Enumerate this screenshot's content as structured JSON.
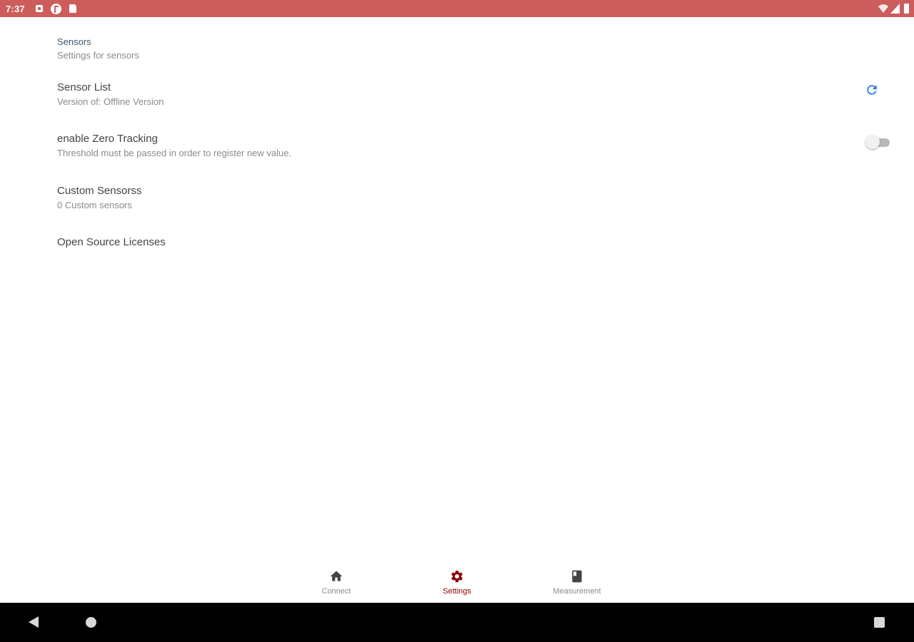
{
  "status_bar": {
    "time": "7:37",
    "color": "#cd5c5c"
  },
  "settings": {
    "category": {
      "title": "Sensors",
      "summary": "Settings for sensors"
    },
    "items": [
      {
        "title": "Sensor List",
        "summary": "Version of: Offline Version",
        "widget": "refresh-icon"
      },
      {
        "title": "enable Zero Tracking",
        "summary": "Threshold must be passed in order to register new value.",
        "widget": "toggle-switch",
        "checked": false
      },
      {
        "title": "Custom Sensorss",
        "summary": "0 Custom sensors"
      },
      {
        "title": "Open Source Licenses"
      }
    ]
  },
  "bottom_nav": {
    "items": [
      {
        "label": "Connect",
        "icon": "home-icon",
        "active": false
      },
      {
        "label": "Settings",
        "icon": "gear-icon",
        "active": true
      },
      {
        "label": "Measurement",
        "icon": "book-icon",
        "active": false
      }
    ],
    "active_color": "#8b0000",
    "inactive_color": "#8a8a8a"
  },
  "colors": {
    "accent": "#1a73e8",
    "category_title": "#3d5473"
  }
}
